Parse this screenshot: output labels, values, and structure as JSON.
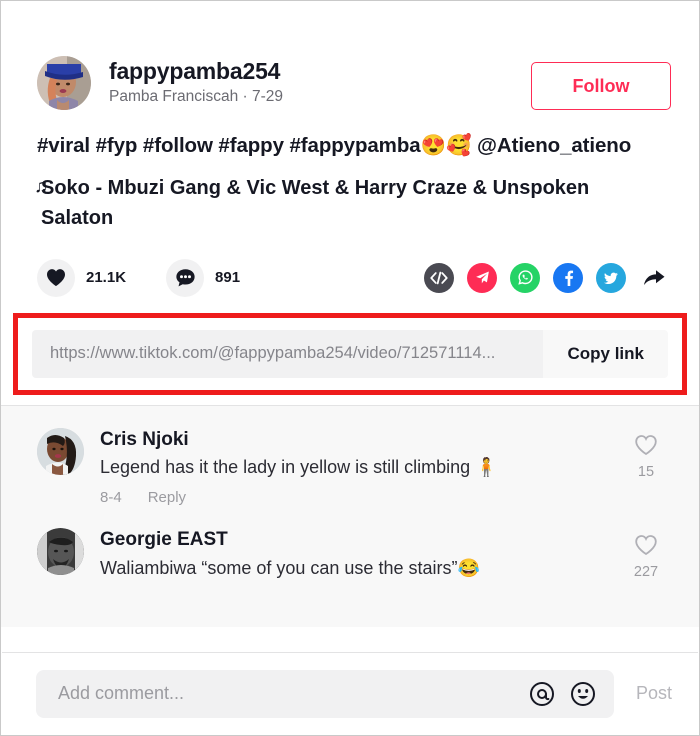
{
  "post": {
    "author_username": "fappypamba254",
    "author_display": "Pamba Franciscah · 7-29",
    "follow_label": "Follow",
    "caption_text": "#viral #fyp #follow #fappy #fappypamba",
    "caption_emoji": "😍🥰",
    "caption_mention": " @Atieno_atieno",
    "music_note": "♫",
    "music_title": "Soko - Mbuzi Gang & Vic West & Harry Craze & Unspoken Salaton"
  },
  "engagement": {
    "like_count": "21.1K",
    "comment_count": "891",
    "like_icon": "heart-icon",
    "comment_icon": "comment-bubble-icon",
    "share_icons": [
      {
        "name": "embed-code-icon",
        "glyph": "</>",
        "color": "#4a4a52"
      },
      {
        "name": "telegram-icon",
        "glyph": "",
        "color": "#fe2c55"
      },
      {
        "name": "whatsapp-icon",
        "glyph": "",
        "color": "#25d366"
      },
      {
        "name": "facebook-icon",
        "glyph": "",
        "color": "#1877f2"
      },
      {
        "name": "twitter-icon",
        "glyph": "",
        "color": "#26a7de"
      },
      {
        "name": "share-arrow-icon",
        "glyph": "➤",
        "color": "#161823"
      }
    ]
  },
  "share_link": {
    "url": "https://www.tiktok.com/@fappypamba254/video/712571114...",
    "copy_label": "Copy link",
    "highlight_color": "#ee1c1c"
  },
  "comments": [
    {
      "name": "Cris Njoki",
      "text": "Legend has it the lady in yellow is still climbing 🧍",
      "date": "8-4",
      "reply_label": "Reply",
      "like_count": "15",
      "avatar": "woman-avatar"
    },
    {
      "name": "Georgie EAST",
      "text": "Waliambiwa “some of you can use the stairs”😂",
      "date": "",
      "reply_label": "",
      "like_count": "227",
      "avatar": "man-avatar"
    }
  ],
  "footer": {
    "placeholder": "Add comment...",
    "input_value": "",
    "mention_icon": "at-mention-icon",
    "emoji_icon": "emoji-face-icon",
    "post_label": "Post"
  }
}
